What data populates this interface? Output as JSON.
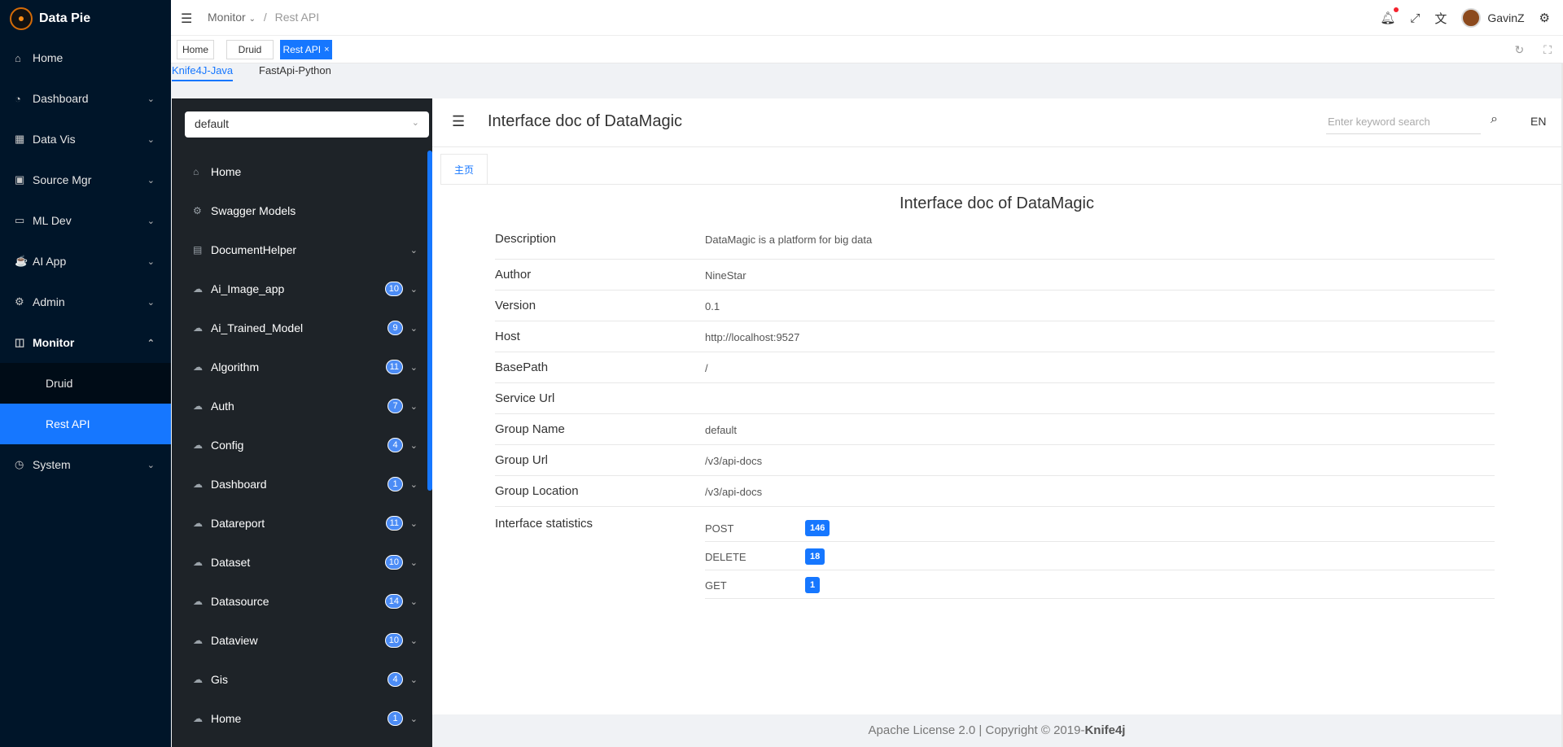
{
  "app": {
    "name": "Data Pie"
  },
  "sidebar": {
    "items": [
      {
        "label": "Home",
        "icon": "home-icon",
        "chev": ""
      },
      {
        "label": "Dashboard",
        "icon": "dashboard-icon",
        "chev": "⌄"
      },
      {
        "label": "Data Vis",
        "icon": "grid-icon",
        "chev": "⌄"
      },
      {
        "label": "Source Mgr",
        "icon": "database-icon",
        "chev": "⌄"
      },
      {
        "label": "ML Dev",
        "icon": "monitor-icon",
        "chev": "⌄"
      },
      {
        "label": "AI App",
        "icon": "cup-icon",
        "chev": "⌄"
      },
      {
        "label": "Admin",
        "icon": "gear-icon",
        "chev": "⌄"
      },
      {
        "label": "Monitor",
        "icon": "chart-monitor-icon",
        "chev": "⌃"
      }
    ],
    "monitor_sub": [
      {
        "label": "Druid"
      },
      {
        "label": "Rest API"
      }
    ],
    "system": {
      "label": "System",
      "chev": "⌄"
    }
  },
  "header": {
    "breadcrumb": {
      "parent": "Monitor",
      "sep": "/",
      "current": "Rest API"
    },
    "user": "GavinZ"
  },
  "tabs": [
    {
      "label": "Home"
    },
    {
      "label": "Druid"
    },
    {
      "label": "Rest API",
      "close": "×"
    }
  ],
  "subtabs": [
    {
      "label": "Knife4J-Java"
    },
    {
      "label": "FastApi-Python"
    }
  ],
  "doc": {
    "group_select": "default",
    "menu": [
      {
        "label": "Home",
        "icon": "home-icon",
        "badge": "",
        "chev": ""
      },
      {
        "label": "Swagger Models",
        "icon": "gear-icon",
        "badge": "",
        "chev": ""
      },
      {
        "label": "DocumentHelper",
        "icon": "document-icon",
        "badge": "",
        "chev": "⌄"
      },
      {
        "label": "Ai_Image_app",
        "icon": "cloud-icon",
        "badge": "10",
        "chev": "⌄"
      },
      {
        "label": "Ai_Trained_Model",
        "icon": "cloud-icon",
        "badge": "9",
        "chev": "⌄"
      },
      {
        "label": "Algorithm",
        "icon": "cloud-icon",
        "badge": "11",
        "chev": "⌄"
      },
      {
        "label": "Auth",
        "icon": "cloud-icon",
        "badge": "7",
        "chev": "⌄"
      },
      {
        "label": "Config",
        "icon": "cloud-icon",
        "badge": "4",
        "chev": "⌄"
      },
      {
        "label": "Dashboard",
        "icon": "cloud-icon",
        "badge": "1",
        "chev": "⌄"
      },
      {
        "label": "Datareport",
        "icon": "cloud-icon",
        "badge": "11",
        "chev": "⌄"
      },
      {
        "label": "Dataset",
        "icon": "cloud-icon",
        "badge": "10",
        "chev": "⌄"
      },
      {
        "label": "Datasource",
        "icon": "cloud-icon",
        "badge": "14",
        "chev": "⌄"
      },
      {
        "label": "Dataview",
        "icon": "cloud-icon",
        "badge": "10",
        "chev": "⌄"
      },
      {
        "label": "Gis",
        "icon": "cloud-icon",
        "badge": "4",
        "chev": "⌄"
      },
      {
        "label": "Home",
        "icon": "cloud-icon",
        "badge": "1",
        "chev": "⌄"
      }
    ],
    "header_title": "Interface doc of DataMagic",
    "search_placeholder": "Enter keyword search",
    "lang": "EN",
    "tab": "主页",
    "title": "Interface doc of DataMagic",
    "info": [
      {
        "key": "Description",
        "value": "DataMagic is a platform for big data"
      },
      {
        "key": "Author",
        "value": "NineStar"
      },
      {
        "key": "Version",
        "value": "0.1"
      },
      {
        "key": "Host",
        "value": "http://localhost:9527"
      },
      {
        "key": "BasePath",
        "value": "/"
      },
      {
        "key": "Service Url",
        "value": ""
      },
      {
        "key": "Group Name",
        "value": "default"
      },
      {
        "key": "Group Url",
        "value": "/v3/api-docs"
      },
      {
        "key": "Group Location",
        "value": "/v3/api-docs"
      }
    ],
    "stats_label": "Interface statistics",
    "stats": [
      {
        "method": "POST",
        "count": "146"
      },
      {
        "method": "DELETE",
        "count": "18"
      },
      {
        "method": "GET",
        "count": "1"
      }
    ],
    "footer": {
      "license": "Apache License 2.0 | Copyright ",
      "copy": "©",
      "year": " 2019-",
      "brand": "Knife4j"
    }
  }
}
